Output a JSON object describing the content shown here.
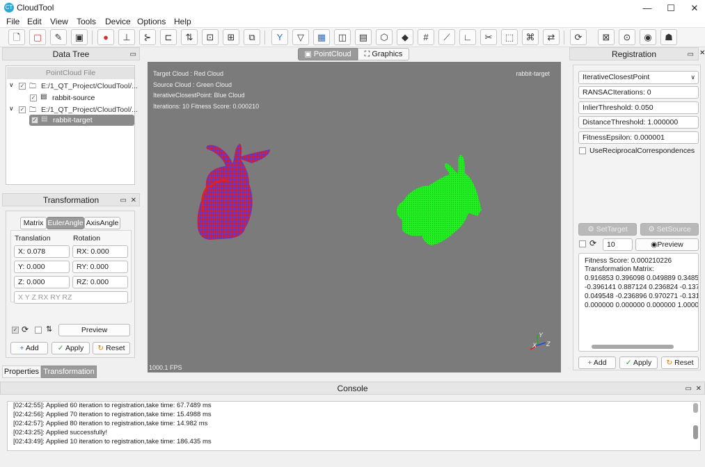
{
  "window": {
    "title": "CloudTool",
    "icon": "CT",
    "minimize": "—",
    "maximize": "☐",
    "close": "✕"
  },
  "menu": [
    "File",
    "Edit",
    "View",
    "Tools",
    "Device",
    "Options",
    "Help"
  ],
  "toolbar_icons": [
    "new-file-icon",
    "open-file-icon",
    "clean-icon",
    "save-icon",
    "color-wheel-icon",
    "axis-icon",
    "merge-icon",
    "split-icon",
    "align-icon",
    "box-icon",
    "bounding-icon",
    "copy-icon",
    "filter-y-icon",
    "filter-funnel-icon",
    "grid-icon",
    "layers-icon",
    "frame-icon",
    "mesh-icon",
    "cube-icon",
    "hash-icon",
    "ruler-icon",
    "angle-icon",
    "cut-icon",
    "select-box-icon",
    "segment-icon",
    "route-icon",
    "refresh-icon",
    "zoom-fit-icon",
    "capture-icon",
    "play-icon",
    "pointer-icon"
  ],
  "data_tree": {
    "title": "Data Tree",
    "header": "PointCloud File",
    "items": [
      {
        "label": "E:/1_QT_Project/CloudTool/...",
        "level": 0
      },
      {
        "label": "rabbit-source",
        "level": 1
      },
      {
        "label": "E:/1_QT_Project/CloudTool/...",
        "level": 0
      },
      {
        "label": "rabbit-target",
        "level": 1,
        "selected": true
      }
    ]
  },
  "transformation": {
    "title": "Transformation",
    "tabs": [
      "Matrix",
      "EulerAngle",
      "AxisAngle"
    ],
    "active_tab": "EulerAngle",
    "translation_label": "Translation",
    "rotation_label": "Rotation",
    "x": "X: 0.078",
    "y": "Y: 0.000",
    "z": "Z: 0.000",
    "rx": "RX: 0.000",
    "ry": "RY: 0.000",
    "rz": "RZ: 0.000",
    "placeholder": "X Y Z RX RY RZ",
    "preview": "Preview",
    "add": "Add",
    "apply": "Apply",
    "reset": "Reset"
  },
  "bottom_tabs": [
    "Properties",
    "Transformation"
  ],
  "center_tabs": [
    "PointCloud",
    "Graphics"
  ],
  "viewer": {
    "overlay": [
      "Target Cloud : Red Cloud",
      "Source Cloud : Green Cloud",
      "IterativeClosestPoint: Blue Cloud",
      "Iterations: 10 Fitness Score: 0.000210"
    ],
    "name": "rabbit-target",
    "fps": "1000.1 FPS",
    "axes": {
      "x": "X",
      "y": "Y",
      "z": "Z"
    },
    "colors": {
      "background": "#7b7b7b",
      "red": "#e02020",
      "green": "#20e020",
      "blue": "#3a3aff"
    }
  },
  "registration": {
    "title": "Registration",
    "method": "IterativeClosestPoint",
    "ransac": "RANSACIterations: 0",
    "inlier": "InlierThreshold: 0.050",
    "distance": "DistanceThreshold: 1.000000",
    "fitness_eps": "FitnessEpsilon: 0.000001",
    "reciprocal": "UseReciprocalCorrespondences",
    "set_target": "SetTarget",
    "set_source": "SetSource",
    "iterations": "10",
    "preview": "Preview",
    "result": [
      "Fitness Score: 0.000210226",
      "Transformation Matrix:",
      "0.916853 0.396098 0.049889 0.3485",
      "-0.396141 0.887124 0.236824 -0.137",
      "0.049548 -0.236896 0.970271 -0.131",
      "0.000000 0.000000 0.000000 1.0000"
    ],
    "add": "Add",
    "apply": "Apply",
    "reset": "Reset"
  },
  "console": {
    "title": "Console",
    "lines": [
      "[02:42:55]: Applied 60 iteration to registration,take time: 67.7489 ms",
      "[02:42:56]: Applied 70 iteration to registration,take time: 15.4988 ms",
      "[02:42:57]: Applied 80 iteration to registration,take time: 14.982 ms",
      "[02:43:25]: Applied successfully!",
      "[02:43:49]: Applied 10 iteration to registration,take time: 186.435 ms"
    ]
  }
}
